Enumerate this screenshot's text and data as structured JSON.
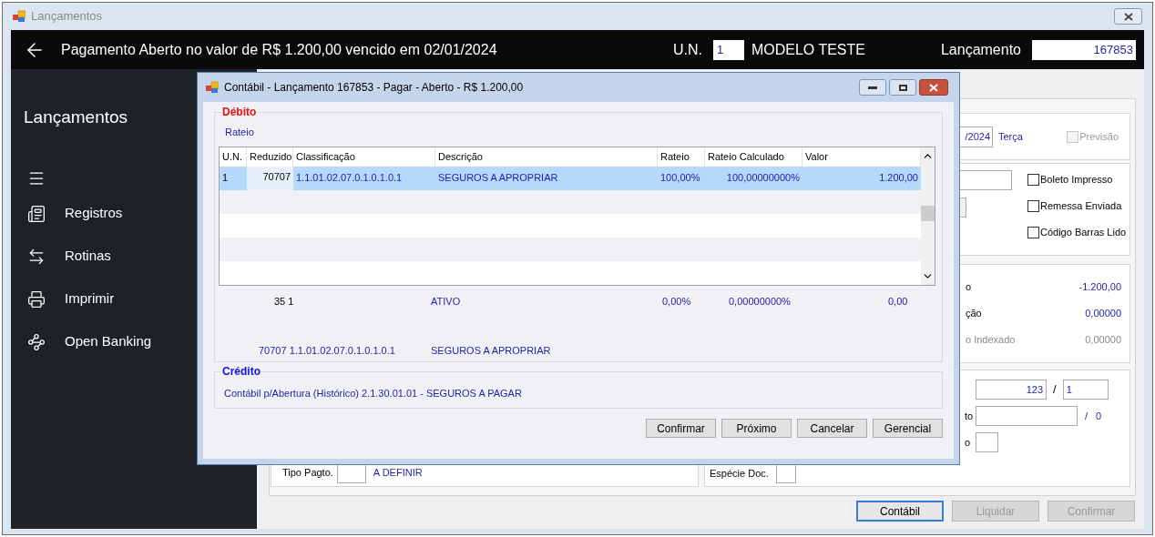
{
  "window": {
    "title": "Lançamentos"
  },
  "header": {
    "title": "Pagamento Aberto no valor de R$ 1.200,00 vencido em 02/01/2024",
    "un_label": "U.N.",
    "un_value": "1",
    "company": "MODELO TESTE",
    "entry_label": "Lançamento",
    "entry_value": "167853"
  },
  "sidebar": {
    "title": "Lançamentos",
    "items": [
      {
        "label": "Registros"
      },
      {
        "label": "Rotinas"
      },
      {
        "label": "Imprimir"
      },
      {
        "label": "Open Banking"
      }
    ]
  },
  "form": {
    "date_value": "/2024",
    "weekday": "Terça",
    "forecast": {
      "label": "Previsão",
      "checked": false,
      "disabled": true
    },
    "flags": [
      {
        "label": "Boleto Impresso",
        "checked": false
      },
      {
        "label": "Remessa Enviada",
        "checked": false
      },
      {
        "label": "Código Barras Lido",
        "checked": false
      }
    ],
    "totals": [
      {
        "label": "o",
        "value": "-1.200,00",
        "disabled": false
      },
      {
        "label": "ção",
        "value": "0,00000",
        "disabled": false
      },
      {
        "label": "o Indexado",
        "value": "0,00000",
        "disabled": true
      }
    ],
    "document": {
      "number": "123",
      "separator": "/",
      "series": "1"
    },
    "row_2": {
      "label": "to",
      "separator": "/",
      "value": "0"
    },
    "row_3": {
      "label": "o"
    },
    "especie": {
      "label": "Espécie Doc."
    },
    "tipo_pagto": {
      "label": "Tipo Pagto.",
      "value": "A DEFINIR"
    }
  },
  "buttons": [
    {
      "label": "Contábil",
      "disabled": false,
      "focused": true
    },
    {
      "label": "Liquidar",
      "disabled": true,
      "focused": false
    },
    {
      "label": "Confirmar",
      "disabled": true,
      "focused": false
    }
  ],
  "dialog": {
    "title": "Contábil - Lançamento 167853 - Pagar - Aberto - R$ 1.200,00",
    "debit": {
      "title": "Débito",
      "link": "Rateio",
      "table": {
        "columns": [
          "U.N.",
          "Reduzido",
          "Classificação",
          "Descrição",
          "Rateio",
          "Rateio Calculado",
          "Valor"
        ],
        "rows": [
          {
            "cells": [
              "1",
              "70707",
              "1.1.01.02.07.0.1.0.1.0.1",
              "SEGUROS A APROPRIAR",
              "100,00%",
              "100,00000000%",
              "1.200,00"
            ],
            "selected": true
          }
        ]
      },
      "summary": [
        "35 1",
        "ATIVO",
        "0,00%",
        "0,00000000%",
        "0,00"
      ],
      "account": [
        "70707 1.1.01.02.07.0.1.0.1.0.1",
        "SEGUROS A APROPRIAR"
      ]
    },
    "credit": {
      "title": "Crédito",
      "text": "Contábil p/Abertura (Histórico) 2.1.30.01.01 - SEGUROS A PAGAR"
    },
    "buttons": [
      "Confirmar",
      "Próximo",
      "Cancelar",
      "Gerencial"
    ]
  }
}
